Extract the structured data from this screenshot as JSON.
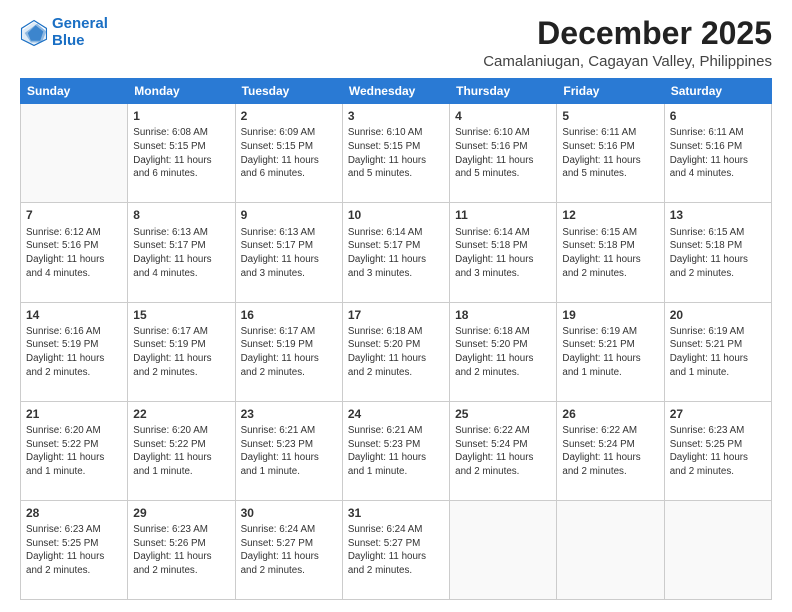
{
  "header": {
    "logo_line1": "General",
    "logo_line2": "Blue",
    "month": "December 2025",
    "location": "Camalaniugan, Cagayan Valley, Philippines"
  },
  "weekdays": [
    "Sunday",
    "Monday",
    "Tuesday",
    "Wednesday",
    "Thursday",
    "Friday",
    "Saturday"
  ],
  "weeks": [
    [
      {
        "day": "",
        "info": ""
      },
      {
        "day": "1",
        "info": "Sunrise: 6:08 AM\nSunset: 5:15 PM\nDaylight: 11 hours\nand 6 minutes."
      },
      {
        "day": "2",
        "info": "Sunrise: 6:09 AM\nSunset: 5:15 PM\nDaylight: 11 hours\nand 6 minutes."
      },
      {
        "day": "3",
        "info": "Sunrise: 6:10 AM\nSunset: 5:15 PM\nDaylight: 11 hours\nand 5 minutes."
      },
      {
        "day": "4",
        "info": "Sunrise: 6:10 AM\nSunset: 5:16 PM\nDaylight: 11 hours\nand 5 minutes."
      },
      {
        "day": "5",
        "info": "Sunrise: 6:11 AM\nSunset: 5:16 PM\nDaylight: 11 hours\nand 5 minutes."
      },
      {
        "day": "6",
        "info": "Sunrise: 6:11 AM\nSunset: 5:16 PM\nDaylight: 11 hours\nand 4 minutes."
      }
    ],
    [
      {
        "day": "7",
        "info": "Sunrise: 6:12 AM\nSunset: 5:16 PM\nDaylight: 11 hours\nand 4 minutes."
      },
      {
        "day": "8",
        "info": "Sunrise: 6:13 AM\nSunset: 5:17 PM\nDaylight: 11 hours\nand 4 minutes."
      },
      {
        "day": "9",
        "info": "Sunrise: 6:13 AM\nSunset: 5:17 PM\nDaylight: 11 hours\nand 3 minutes."
      },
      {
        "day": "10",
        "info": "Sunrise: 6:14 AM\nSunset: 5:17 PM\nDaylight: 11 hours\nand 3 minutes."
      },
      {
        "day": "11",
        "info": "Sunrise: 6:14 AM\nSunset: 5:18 PM\nDaylight: 11 hours\nand 3 minutes."
      },
      {
        "day": "12",
        "info": "Sunrise: 6:15 AM\nSunset: 5:18 PM\nDaylight: 11 hours\nand 2 minutes."
      },
      {
        "day": "13",
        "info": "Sunrise: 6:15 AM\nSunset: 5:18 PM\nDaylight: 11 hours\nand 2 minutes."
      }
    ],
    [
      {
        "day": "14",
        "info": "Sunrise: 6:16 AM\nSunset: 5:19 PM\nDaylight: 11 hours\nand 2 minutes."
      },
      {
        "day": "15",
        "info": "Sunrise: 6:17 AM\nSunset: 5:19 PM\nDaylight: 11 hours\nand 2 minutes."
      },
      {
        "day": "16",
        "info": "Sunrise: 6:17 AM\nSunset: 5:19 PM\nDaylight: 11 hours\nand 2 minutes."
      },
      {
        "day": "17",
        "info": "Sunrise: 6:18 AM\nSunset: 5:20 PM\nDaylight: 11 hours\nand 2 minutes."
      },
      {
        "day": "18",
        "info": "Sunrise: 6:18 AM\nSunset: 5:20 PM\nDaylight: 11 hours\nand 2 minutes."
      },
      {
        "day": "19",
        "info": "Sunrise: 6:19 AM\nSunset: 5:21 PM\nDaylight: 11 hours\nand 1 minute."
      },
      {
        "day": "20",
        "info": "Sunrise: 6:19 AM\nSunset: 5:21 PM\nDaylight: 11 hours\nand 1 minute."
      }
    ],
    [
      {
        "day": "21",
        "info": "Sunrise: 6:20 AM\nSunset: 5:22 PM\nDaylight: 11 hours\nand 1 minute."
      },
      {
        "day": "22",
        "info": "Sunrise: 6:20 AM\nSunset: 5:22 PM\nDaylight: 11 hours\nand 1 minute."
      },
      {
        "day": "23",
        "info": "Sunrise: 6:21 AM\nSunset: 5:23 PM\nDaylight: 11 hours\nand 1 minute."
      },
      {
        "day": "24",
        "info": "Sunrise: 6:21 AM\nSunset: 5:23 PM\nDaylight: 11 hours\nand 1 minute."
      },
      {
        "day": "25",
        "info": "Sunrise: 6:22 AM\nSunset: 5:24 PM\nDaylight: 11 hours\nand 2 minutes."
      },
      {
        "day": "26",
        "info": "Sunrise: 6:22 AM\nSunset: 5:24 PM\nDaylight: 11 hours\nand 2 minutes."
      },
      {
        "day": "27",
        "info": "Sunrise: 6:23 AM\nSunset: 5:25 PM\nDaylight: 11 hours\nand 2 minutes."
      }
    ],
    [
      {
        "day": "28",
        "info": "Sunrise: 6:23 AM\nSunset: 5:25 PM\nDaylight: 11 hours\nand 2 minutes."
      },
      {
        "day": "29",
        "info": "Sunrise: 6:23 AM\nSunset: 5:26 PM\nDaylight: 11 hours\nand 2 minutes."
      },
      {
        "day": "30",
        "info": "Sunrise: 6:24 AM\nSunset: 5:27 PM\nDaylight: 11 hours\nand 2 minutes."
      },
      {
        "day": "31",
        "info": "Sunrise: 6:24 AM\nSunset: 5:27 PM\nDaylight: 11 hours\nand 2 minutes."
      },
      {
        "day": "",
        "info": ""
      },
      {
        "day": "",
        "info": ""
      },
      {
        "day": "",
        "info": ""
      }
    ]
  ]
}
